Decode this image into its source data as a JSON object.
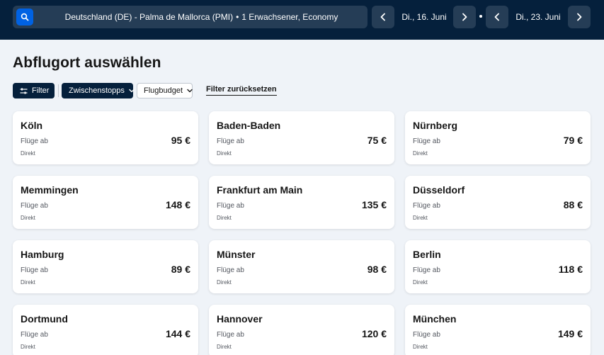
{
  "colors": {
    "header_bg": "#05203c",
    "header_field": "#253d56",
    "accent": "#0062e3",
    "page_bg": "#eff3f8",
    "card_bg": "#ffffff"
  },
  "header": {
    "route": "Deutschland (DE) - Palma de Mallorca (PMI)",
    "separator": "•",
    "passengers": "1 Erwachsener, Economy",
    "outbound_date": "Di., 16. Juni",
    "return_date": "Di., 23. Juni",
    "search_icon": "search-icon",
    "prev_icon": "chevron-left-icon",
    "next_icon": "chevron-right-icon"
  },
  "page": {
    "title": "Abflugort auswählen"
  },
  "filters": {
    "filter_label": "Filter",
    "filter_icon": "sliders-icon",
    "stops_label": "Zwischenstopps",
    "budget_label": "Flugbudget",
    "reset_label": "Filter zurücksetzen"
  },
  "results": [
    {
      "city": "Köln",
      "sub": "Flüge ab",
      "price": "95 €",
      "stops": "Direkt"
    },
    {
      "city": "Baden-Baden",
      "sub": "Flüge ab",
      "price": "75 €",
      "stops": "Direkt"
    },
    {
      "city": "Nürnberg",
      "sub": "Flüge ab",
      "price": "79 €",
      "stops": "Direkt"
    },
    {
      "city": "Memmingen",
      "sub": "Flüge ab",
      "price": "148 €",
      "stops": "Direkt"
    },
    {
      "city": "Frankfurt am Main",
      "sub": "Flüge ab",
      "price": "135 €",
      "stops": "Direkt"
    },
    {
      "city": "Düsseldorf",
      "sub": "Flüge ab",
      "price": "88 €",
      "stops": "Direkt"
    },
    {
      "city": "Hamburg",
      "sub": "Flüge ab",
      "price": "89 €",
      "stops": "Direkt"
    },
    {
      "city": "Münster",
      "sub": "Flüge ab",
      "price": "98 €",
      "stops": "Direkt"
    },
    {
      "city": "Berlin",
      "sub": "Flüge ab",
      "price": "118 €",
      "stops": "Direkt"
    },
    {
      "city": "Dortmund",
      "sub": "Flüge ab",
      "price": "144 €",
      "stops": "Direkt"
    },
    {
      "city": "Hannover",
      "sub": "Flüge ab",
      "price": "120 €",
      "stops": "Direkt"
    },
    {
      "city": "München",
      "sub": "Flüge ab",
      "price": "149 €",
      "stops": "Direkt"
    }
  ]
}
